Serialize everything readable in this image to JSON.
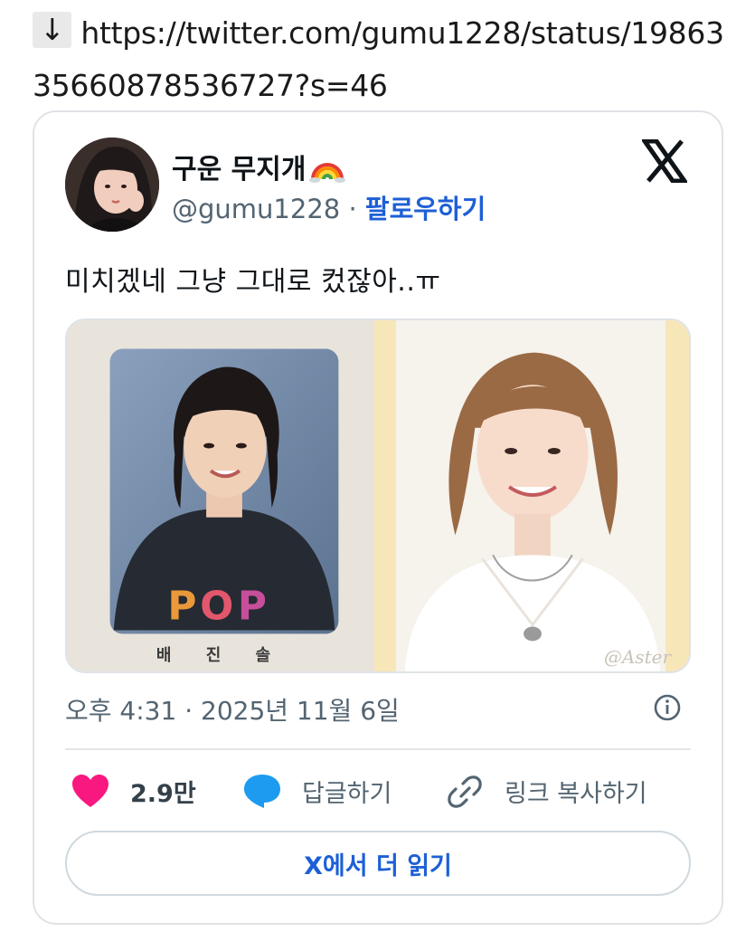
{
  "url_line": {
    "arrow": "↓",
    "url": "https://twitter.com/gumu1228/status/1986335660878536727?s=46"
  },
  "tweet": {
    "display_name": "구운 무지개",
    "name_emoji_icon": "rainbow-icon",
    "handle": "@gumu1228",
    "separator": " · ",
    "follow_label": "팔로우하기",
    "text": "미치겠네 그냥 그대로 컸잖아..ㅠ",
    "media": {
      "left_photo_caption": "배 진 솔",
      "right_photo_watermark": "@Aster"
    },
    "timestamp": "오후 4:31 · 2025년 11월 6일",
    "actions": {
      "like_count": "2.9만",
      "reply_label": "답글하기",
      "copy_link_label": "링크 복사하기"
    },
    "read_more_label": "X에서 더 읽기"
  },
  "colors": {
    "like": "#f91880",
    "reply": "#1d9bf0",
    "link": "#1d5fd6",
    "secondary_text": "#536471"
  }
}
